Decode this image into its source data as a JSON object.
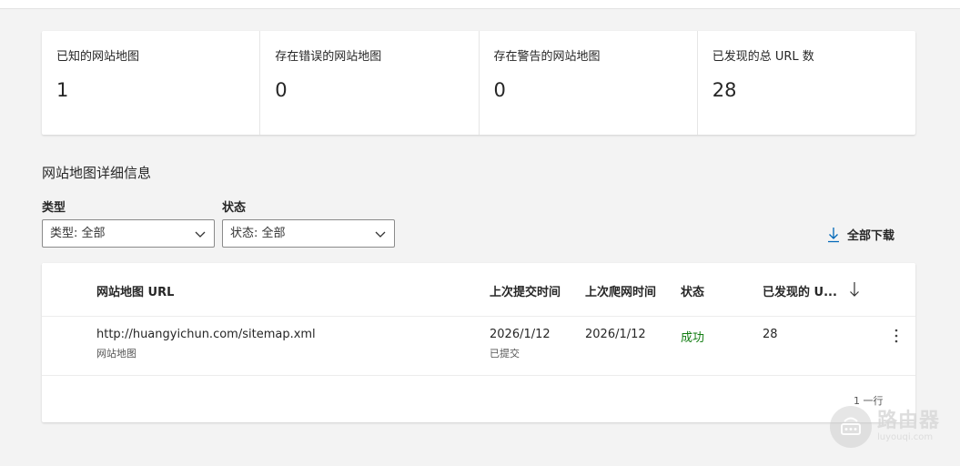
{
  "stats": [
    {
      "label": "已知的网站地图",
      "value": "1"
    },
    {
      "label": "存在错误的网站地图",
      "value": "0"
    },
    {
      "label": "存在警告的网站地图",
      "value": "0"
    },
    {
      "label": "已发现的总 URL 数",
      "value": "28"
    }
  ],
  "details": {
    "title": "网站地图详细信息",
    "filters": {
      "type_label": "类型",
      "type_value": "类型: 全部",
      "status_label": "状态",
      "status_value": "状态: 全部"
    },
    "download_label": "全部下载"
  },
  "table": {
    "columns": {
      "url": "网站地图 URL",
      "submitted": "上次提交时间",
      "crawled": "上次爬网时间",
      "status": "状态",
      "discovered": "已发现的 U..."
    },
    "rows": [
      {
        "url": "http://huangyichun.com/sitemap.xml",
        "url_type": "网站地图",
        "submitted": "2026/1/12",
        "submitted_sub": "已提交",
        "crawled": "2026/1/12",
        "status": "成功",
        "discovered": "28"
      }
    ],
    "row_count": "1 一行"
  },
  "watermark": {
    "main": "路由器",
    "sub": "luyouqi.com"
  },
  "colors": {
    "success": "#107c10",
    "background": "#f3f3f3"
  }
}
